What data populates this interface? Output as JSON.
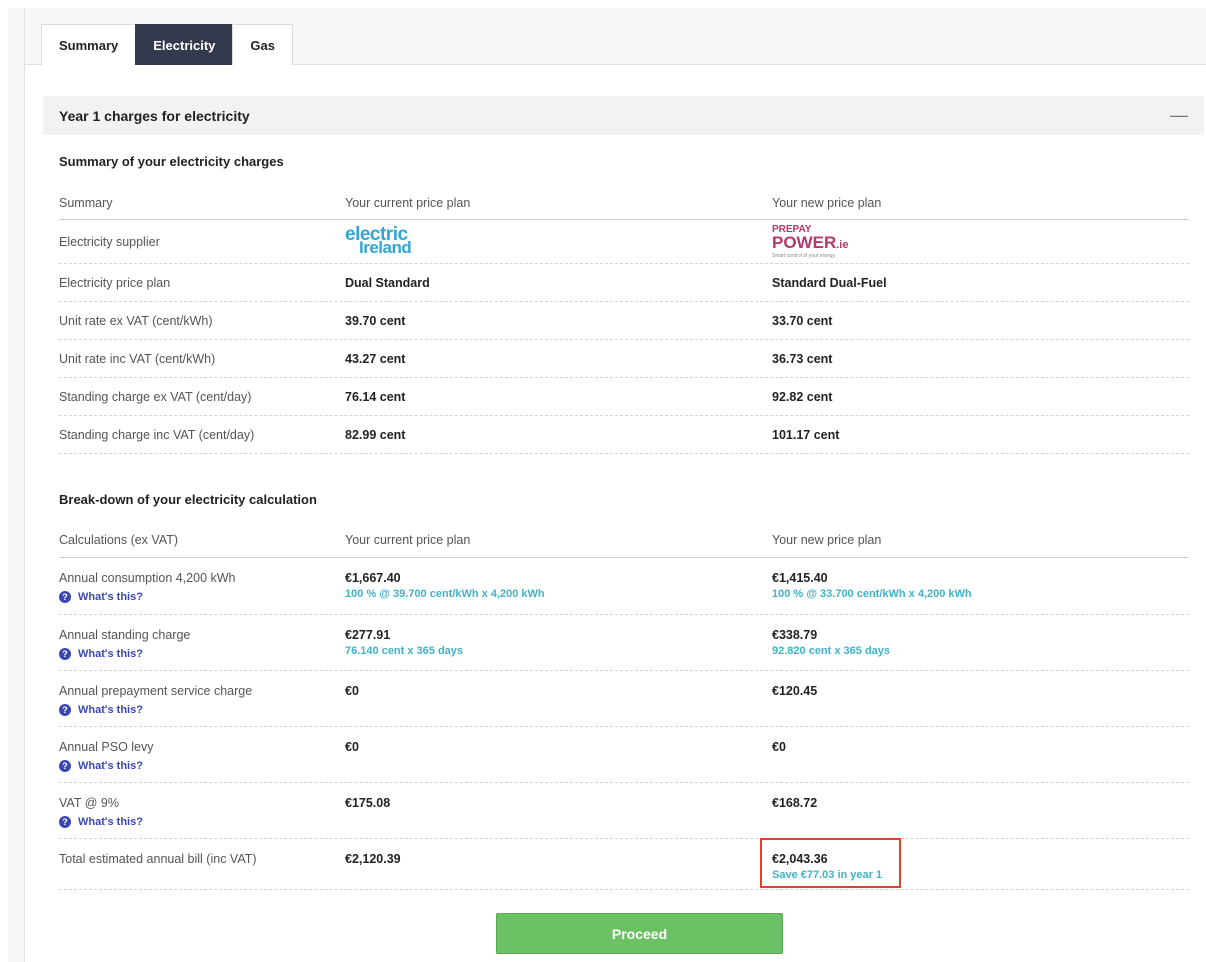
{
  "tabs": [
    {
      "label": "Summary",
      "active": false
    },
    {
      "label": "Electricity",
      "active": true
    },
    {
      "label": "Gas",
      "active": false
    }
  ],
  "accordion": {
    "title": "Year 1 charges for electricity",
    "toggle": "—"
  },
  "summary": {
    "title": "Summary of your electricity charges",
    "headers": [
      "Summary",
      "Your current price plan",
      "Your new price plan"
    ],
    "supplier_label": "Electricity supplier",
    "current_logo": {
      "line1": "electric",
      "line2": "Ireland",
      "color": "#31a6d6"
    },
    "new_logo": {
      "line1": "PREPAY",
      "line2": "POWER",
      "suffix": ".ie",
      "tagline": "Smart control of your energy",
      "color": "#b4386c"
    },
    "rows": [
      {
        "label": "Electricity price plan",
        "current": "Dual Standard",
        "new": "Standard Dual-Fuel"
      },
      {
        "label": "Unit rate ex VAT (cent/kWh)",
        "current": "39.70 cent",
        "new": "33.70 cent"
      },
      {
        "label": "Unit rate inc VAT (cent/kWh)",
        "current": "43.27 cent",
        "new": "36.73 cent"
      },
      {
        "label": "Standing charge ex VAT (cent/day)",
        "current": "76.14 cent",
        "new": "92.82 cent"
      },
      {
        "label": "Standing charge inc VAT (cent/day)",
        "current": "82.99 cent",
        "new": "101.17 cent"
      }
    ]
  },
  "breakdown": {
    "title": "Break-down of your electricity calculation",
    "headers": [
      "Calculations (ex VAT)",
      "Your current price plan",
      "Your new price plan"
    ],
    "help_label": "What's this?",
    "rows": [
      {
        "label": "Annual consumption 4,200 kWh",
        "current": "€1,667.40",
        "current_sub": "100 % @ 39.700 cent/kWh x 4,200 kWh",
        "new": "€1,415.40",
        "new_sub": "100 % @ 33.700 cent/kWh x 4,200 kWh"
      },
      {
        "label": "Annual standing charge",
        "current": "€277.91",
        "current_sub": "76.140 cent x 365 days",
        "new": "€338.79",
        "new_sub": "92.820 cent x 365 days"
      },
      {
        "label": "Annual prepayment service charge",
        "current": "€0",
        "new": "€120.45"
      },
      {
        "label": "Annual PSO levy",
        "current": "€0",
        "new": "€0"
      },
      {
        "label": "VAT @ 9%",
        "current": "€175.08",
        "new": "€168.72"
      }
    ],
    "total": {
      "label": "Total estimated annual bill (inc VAT)",
      "current": "€2,120.39",
      "new": "€2,043.36",
      "new_sub": "Save €77.03 in year 1"
    }
  },
  "proceed_label": "Proceed",
  "colors": {
    "tab_active": "#343a4d",
    "accent": "#3fb3c8",
    "help": "#3b48b4",
    "proceed": "#6cc164",
    "highlight": "#e0412b"
  }
}
